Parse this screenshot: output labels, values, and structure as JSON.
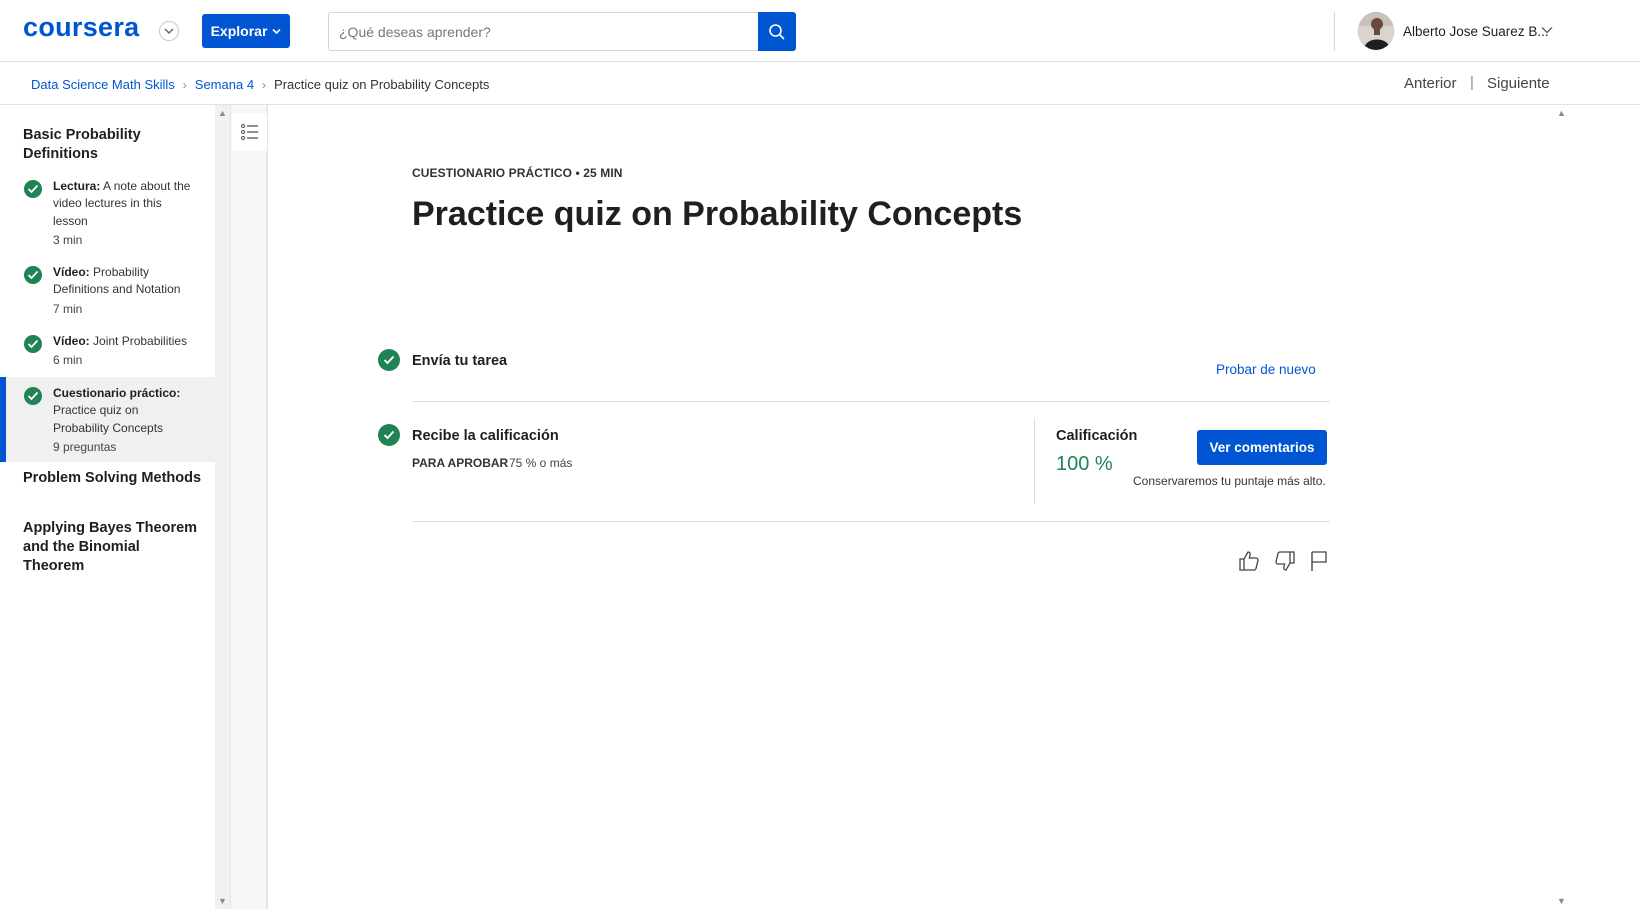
{
  "header": {
    "logo_text": "coursera",
    "explore_label": "Explorar",
    "search_placeholder": "¿Qué deseas aprender?",
    "user_name": "Alberto Jose Suarez B...",
    "brand_color": "#0056d2"
  },
  "breadcrumb": {
    "items": [
      "Data Science Math Skills",
      "Semana 4",
      "Practice quiz on Probability Concepts"
    ],
    "prev_label": "Anterior",
    "separator": "|",
    "next_label": "Siguiente"
  },
  "sidebar": {
    "modules": [
      {
        "title": "Basic Probability Definitions",
        "lessons": [
          {
            "type": "Lectura:",
            "title": "A note about the video lectures in this lesson",
            "meta": "3 min",
            "completed": true,
            "active": false
          },
          {
            "type": "Vídeo:",
            "title": "Probability Definitions and Notation",
            "meta": "7 min",
            "completed": true,
            "active": false
          },
          {
            "type": "Vídeo:",
            "title": "Joint Probabilities",
            "meta": "6 min",
            "completed": true,
            "active": false
          },
          {
            "type": "Cuestionario práctico:",
            "title": "Practice quiz on Probability Concepts",
            "meta": "9 preguntas",
            "completed": true,
            "active": true
          }
        ]
      },
      {
        "title": "Problem Solving Methods"
      },
      {
        "title": "Applying Bayes Theorem and the Binomial Theorem"
      }
    ]
  },
  "main": {
    "eyebrow": "CUESTIONARIO PRÁCTICO • 25 MIN",
    "title": "Practice quiz on Probability Concepts",
    "step1": {
      "title": "Envía tu tarea",
      "retry_label": "Probar de nuevo"
    },
    "step2": {
      "title": "Recibe la calificación",
      "pass_label": "PARA APROBAR",
      "pass_value": "75 % o más",
      "grade_label": "Calificación",
      "grade_value": "100 %",
      "feedback_button": "Ver comentarios",
      "keep_note": "Conservaremos tu puntaje más alto."
    },
    "success_color": "#1f8354",
    "feedback_icons": [
      "like-icon",
      "dislike-icon",
      "flag-icon"
    ]
  }
}
